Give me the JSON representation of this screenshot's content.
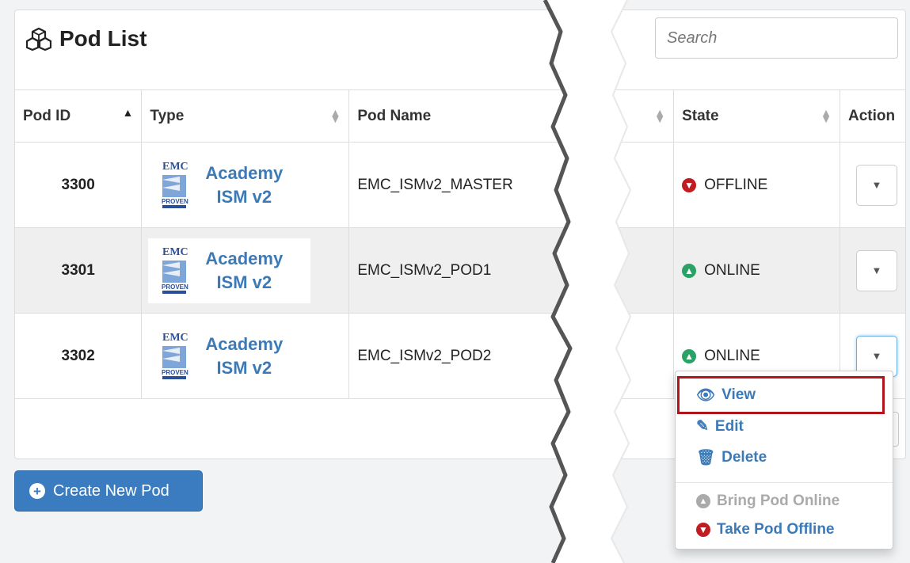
{
  "panel": {
    "title": "Pod List",
    "title_icon": "cubes-icon"
  },
  "search": {
    "placeholder": "Search"
  },
  "columns": {
    "pod_id": "Pod ID",
    "type": "Type",
    "pod_name": "Pod Name",
    "state": "State",
    "action": "Action"
  },
  "rows": [
    {
      "pod_id": "3300",
      "logo_top": "EMC",
      "logo_bottom": "PROVEN",
      "type_l1": "Academy",
      "type_l2": "ISM v2",
      "pod_name": "EMC_ISMv2_MASTER",
      "state": "OFFLINE",
      "state_icon": "arrow-down-circle-icon",
      "state_color": "#c01c22"
    },
    {
      "pod_id": "3301",
      "logo_top": "EMC",
      "logo_bottom": "PROVEN",
      "type_l1": "Academy",
      "type_l2": "ISM v2",
      "pod_name": "EMC_ISMv2_POD1",
      "state": "ONLINE",
      "state_icon": "arrow-up-circle-icon",
      "state_color": "#2aa266"
    },
    {
      "pod_id": "3302",
      "logo_top": "EMC",
      "logo_bottom": "PROVEN",
      "type_l1": "Academy",
      "type_l2": "ISM v2",
      "pod_name": "EMC_ISMv2_POD2",
      "state": "ONLINE",
      "state_icon": "arrow-up-circle-icon",
      "state_color": "#2aa266"
    }
  ],
  "create_button": {
    "label": "Create New Pod",
    "icon": "plus-circle-icon"
  },
  "action_menu": {
    "view": "View",
    "edit": "Edit",
    "delete": "Delete",
    "bring_online": "Bring Pod Online",
    "take_offline": "Take Pod Offline",
    "highlight_color": "#b1141b"
  },
  "colors": {
    "accent": "#3c7ab7",
    "button": "#3a7cbf",
    "offline": "#c01c22",
    "online": "#2aa266"
  }
}
